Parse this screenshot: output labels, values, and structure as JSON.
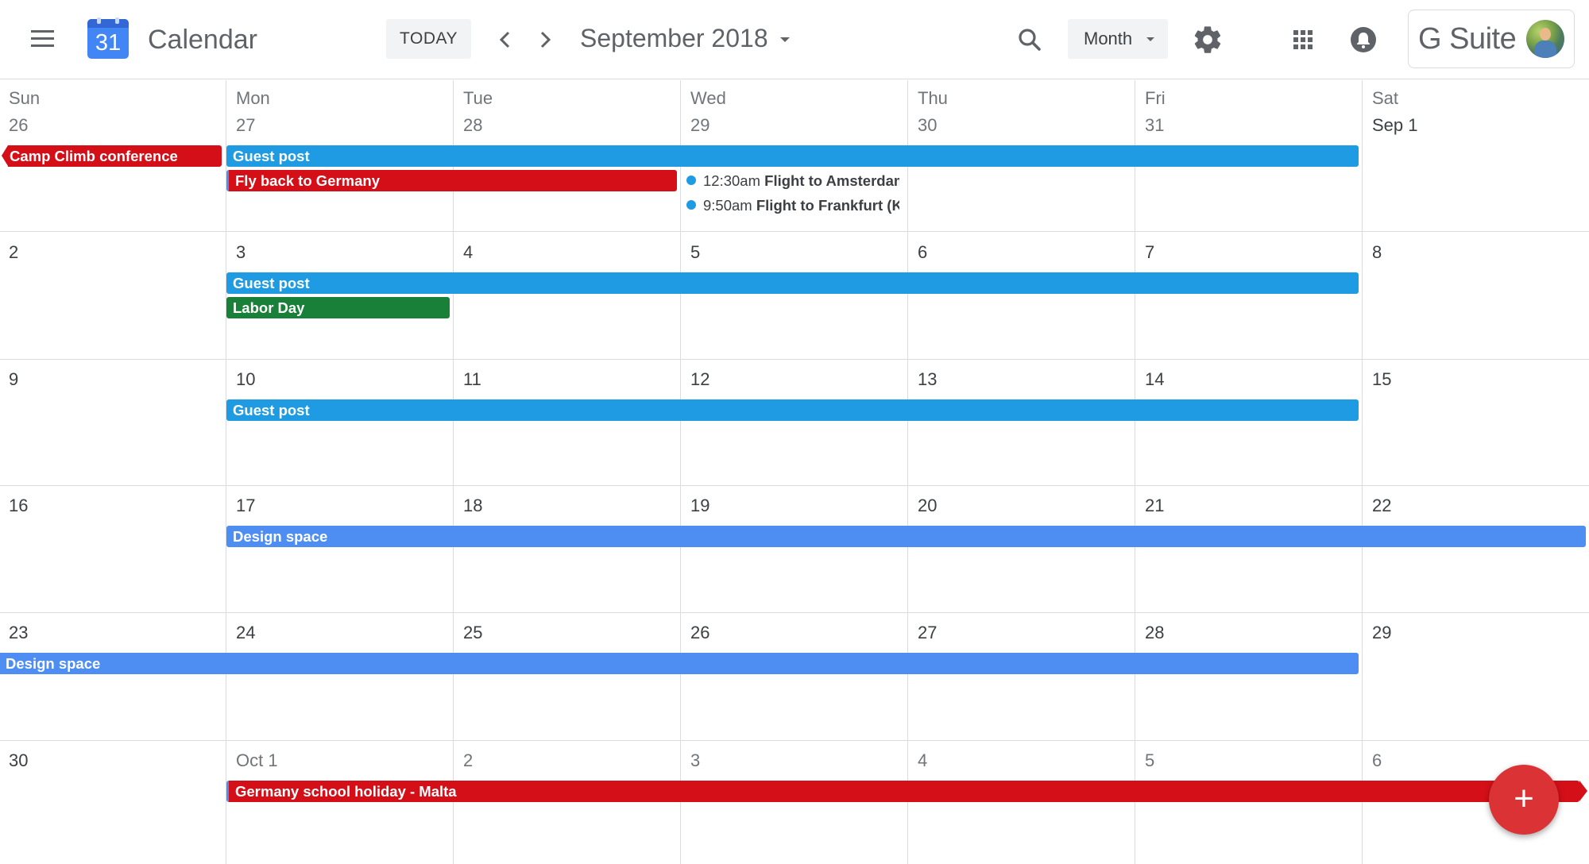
{
  "header": {
    "app_name": "Calendar",
    "logo_day": "31",
    "today_label": "TODAY",
    "current_period": "September 2018",
    "view_label": "Month",
    "brand_label": "G Suite"
  },
  "colors": {
    "guest_post": "#1e9be3",
    "design_space": "#4e8ef2",
    "red_events": "#d50f18",
    "labor_day": "#188038",
    "fab": "#db3236"
  },
  "icons": {
    "menu": "hamburger-icon",
    "prev": "chevron-left-icon",
    "next": "chevron-right-icon",
    "search": "search-icon",
    "settings": "gear-icon",
    "apps": "apps-grid-icon",
    "notifications": "bell-icon",
    "create": "plus-icon"
  },
  "weekdays": [
    "Sun",
    "Mon",
    "Tue",
    "Wed",
    "Thu",
    "Fri",
    "Sat"
  ],
  "weeks": [
    {
      "days": [
        "26",
        "27",
        "28",
        "29",
        "30",
        "31",
        "Sep 1"
      ],
      "events": [
        {
          "title": "Camp Climb conference"
        },
        {
          "title": "Guest post"
        },
        {
          "title": "Fly back to Germany"
        },
        {
          "time": "12:30am",
          "title": "Flight to Amsterdam"
        },
        {
          "time": "9:50am",
          "title": "Flight to Frankfurt (KI"
        }
      ]
    },
    {
      "days": [
        "2",
        "3",
        "4",
        "5",
        "6",
        "7",
        "8"
      ],
      "events": [
        {
          "title": "Guest post"
        },
        {
          "title": "Labor Day"
        }
      ]
    },
    {
      "days": [
        "9",
        "10",
        "11",
        "12",
        "13",
        "14",
        "15"
      ],
      "events": [
        {
          "title": "Guest post"
        }
      ]
    },
    {
      "days": [
        "16",
        "17",
        "18",
        "19",
        "20",
        "21",
        "22"
      ],
      "events": [
        {
          "title": "Design space"
        }
      ]
    },
    {
      "days": [
        "23",
        "24",
        "25",
        "26",
        "27",
        "28",
        "29"
      ],
      "events": [
        {
          "title": "Design space"
        }
      ]
    },
    {
      "days": [
        "30",
        "Oct 1",
        "2",
        "3",
        "4",
        "5",
        "6"
      ],
      "events": [
        {
          "title": "Germany school holiday - Malta"
        }
      ]
    }
  ],
  "fab_label": "+"
}
